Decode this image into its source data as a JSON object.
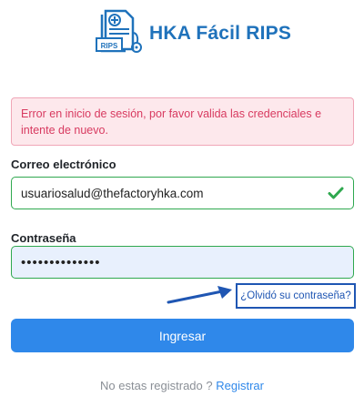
{
  "brand": {
    "name": "HKA Fácil RIPS",
    "logo_text": "RIPS"
  },
  "alert": {
    "message": "Error en inicio de sesión, por favor valida las credenciales e intente de nuevo."
  },
  "email": {
    "label": "Correo electrónico",
    "value": "usuariosalud@thefactoryhka.com"
  },
  "password": {
    "label": "Contraseña",
    "value": "••••••••••••••"
  },
  "forgot_link": "¿Olvidó su contraseña?",
  "submit_label": "Ingresar",
  "footer": {
    "text": "No estas registrado ? ",
    "link": "Registrar"
  },
  "colors": {
    "brand": "#1f72bb",
    "primary": "#2f88ea",
    "error": "#d83a60",
    "success": "#2fa84f",
    "annotation": "#1f56b3"
  }
}
